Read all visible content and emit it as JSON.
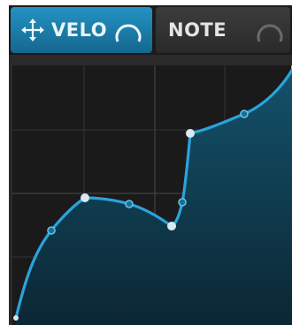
{
  "tabs": [
    {
      "label": "VELO",
      "active": true,
      "icons": [
        "move-arrows-icon",
        "knob-icon"
      ]
    },
    {
      "label": "NOTE",
      "active": false,
      "icons": [
        "knob-icon"
      ]
    }
  ],
  "colors": {
    "accent": "#2aa3dc",
    "tab_active": "#1a7aa8",
    "tab_inactive": "#333333",
    "background": "#1a1a1a",
    "grid": "#3a3a3a",
    "curve": "#2aa3dc",
    "point": "#cfe3ee"
  },
  "graph": {
    "type": "curve-editor",
    "grid": true
  }
}
